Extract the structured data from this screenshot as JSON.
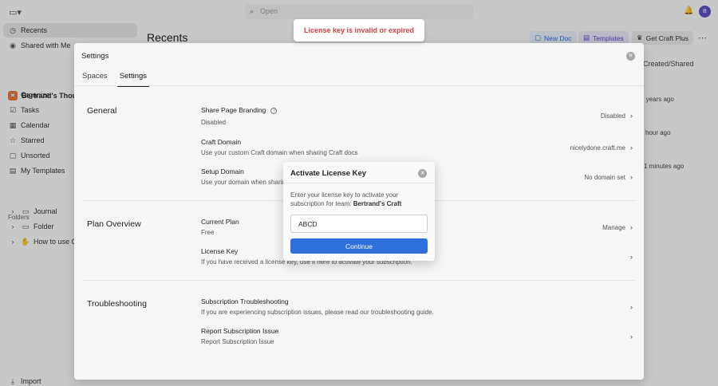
{
  "topbar": {
    "search_placeholder": "Open",
    "avatar_initial": "B"
  },
  "sidebar": {
    "recents": "Recents",
    "shared": "Shared with Me",
    "workspace": "Bertrand's Though",
    "items": [
      "Organize",
      "Tasks",
      "Calendar",
      "Starred",
      "Unsorted",
      "My Templates"
    ],
    "folders_header": "Folders",
    "folders": [
      "Journal",
      "Folder",
      "How to use Cra"
    ],
    "import": "Import"
  },
  "main": {
    "title": "Recents",
    "new_doc": "New Doc",
    "templates": "Templates",
    "get_plus": "Get Craft Plus",
    "created_shared": "Created/Shared",
    "times": [
      "2 years ago",
      "hour ago",
      "1 minutes ago"
    ]
  },
  "toast": {
    "message": "License key is invalid or expired"
  },
  "settings": {
    "title": "Settings",
    "tabs": [
      "Spaces",
      "Settings"
    ],
    "general": {
      "heading": "General",
      "branding_title": "Share Page Branding",
      "branding_desc": "Disabled",
      "branding_value": "Disabled",
      "domain_title": "Craft Domain",
      "domain_desc": "Use your custom Craft domain when sharing Craft docs",
      "domain_value": "nicelydone.craft.me",
      "setup_title": "Setup Domain",
      "setup_desc": "Use your domain when sharing",
      "setup_value": "No domain set"
    },
    "plan": {
      "heading": "Plan Overview",
      "current_title": "Current Plan",
      "current_desc": "Free",
      "current_value": "Manage",
      "license_title": "License Key",
      "license_desc": "If you have received a license key, use it here to activate your subscription."
    },
    "troubleshooting": {
      "heading": "Troubleshooting",
      "sub_title": "Subscription Troubleshooting",
      "sub_desc": "If you are experiencing subscription issues, please read our troubleshooting guide.",
      "report_title": "Report Subscription Issue",
      "report_desc": "Report Subscription Issue"
    }
  },
  "dialog": {
    "title": "Activate License Key",
    "desc_prefix": "Enter your license key to activate your subscription for team: ",
    "team": "Bertrand's Craft",
    "input_value": "ABCD",
    "continue": "Continue"
  }
}
